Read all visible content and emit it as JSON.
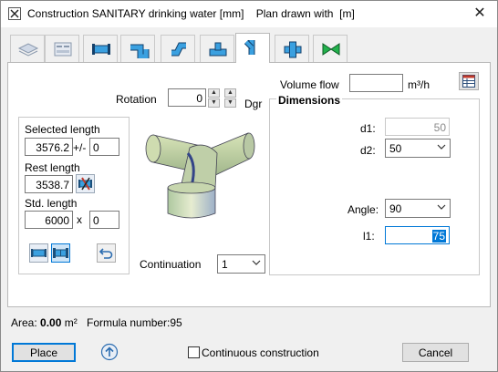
{
  "window": {
    "title": "Construction SANITARY drinking water [mm]    Plan drawn with  [m]",
    "close_symbol": "✕"
  },
  "tabs": [
    {
      "icon": "layers-icon"
    },
    {
      "icon": "form-icon"
    },
    {
      "icon": "pipe-segment-icon"
    },
    {
      "icon": "pipe-bend-icon"
    },
    {
      "icon": "pipe-offset-icon"
    },
    {
      "icon": "pipe-tee-icon"
    },
    {
      "icon": "pipe-branch-icon",
      "active": true
    },
    {
      "icon": "pipe-cross-icon"
    },
    {
      "icon": "valve-icon"
    }
  ],
  "rotation": {
    "label": "Rotation",
    "value": "0",
    "unit": "Dgr"
  },
  "volume_flow": {
    "label": "Volume flow",
    "value": "",
    "unit": "m³/h"
  },
  "lengths": {
    "selected_label": "Selected length",
    "selected_value": "3576.2",
    "tolerance_sign": "+/-",
    "tolerance_value": "0",
    "rest_label": "Rest length",
    "rest_value": "3538.7",
    "std_label": "Std. length",
    "std_value": "6000",
    "multiply_sign": "x",
    "std_count": "0"
  },
  "continuation": {
    "label": "Continuation",
    "value": "1"
  },
  "dimensions": {
    "title": "Dimensions",
    "d1_label": "d1:",
    "d1_value": "50",
    "d2_label": "d2:",
    "d2_value": "50",
    "angle_label": "Angle:",
    "angle_value": "90",
    "l1_label": "l1:",
    "l1_value": "75"
  },
  "status": {
    "area_label": "Area:",
    "area_value": "0.00",
    "area_unit": "m²",
    "formula": "Formula number:95"
  },
  "footer": {
    "place_label": "Place",
    "continuous_label": "Continuous construction",
    "continuous_checked": false,
    "cancel_label": "Cancel"
  },
  "colors": {
    "accent": "#0078d7",
    "pipe_fill": "#c8d8a0",
    "pipe_shade": "#8ea8c8"
  }
}
